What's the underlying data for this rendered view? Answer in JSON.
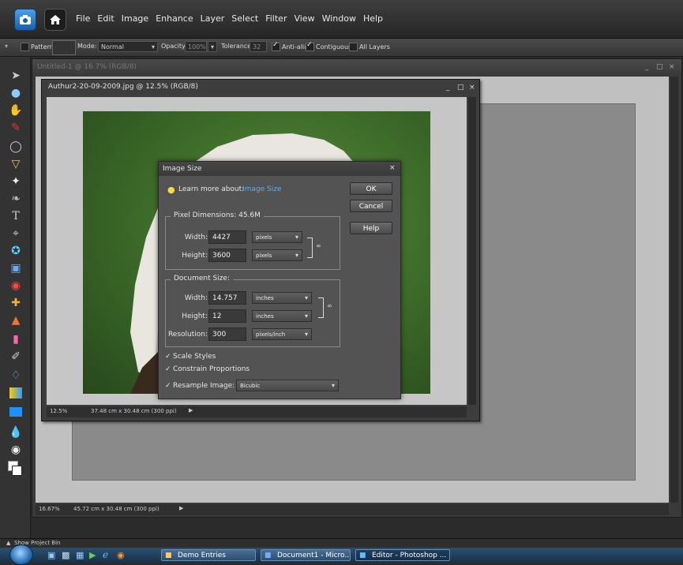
{
  "menubar": {
    "items": [
      "File",
      "Edit",
      "Image",
      "Enhance",
      "Layer",
      "Select",
      "Filter",
      "View",
      "Window",
      "Help"
    ]
  },
  "options_bar": {
    "pattern_label": "Pattern",
    "mode_label": "Mode:",
    "mode_value": "Normal",
    "opacity_label": "Opacity:",
    "opacity_value": "100%",
    "tolerance_label": "Tolerance:",
    "tolerance_value": "32",
    "anti_alias_label": "Anti-alias",
    "contiguous_label": "Contiguous",
    "all_layers_label": "All Layers"
  },
  "doc1": {
    "title": "Untitled-1 @ 16.7% (RGB/8)",
    "zoom": "16.67%",
    "status": "45.72 cm x 30.48 cm (300 ppi)"
  },
  "doc2": {
    "title": "Authur2-20-09-2009.jpg @ 12.5% (RGB/8)",
    "zoom": "12.5%",
    "status": "37.48 cm x 30.48 cm (300 ppi)"
  },
  "dialog": {
    "title": "Image Size",
    "learn_more_label": "Learn more about:",
    "learn_more_link": "Image Size",
    "ok_label": "OK",
    "cancel_label": "Cancel",
    "help_label": "Help",
    "pixel_dimensions": {
      "legend": "Pixel Dimensions: 45.6M",
      "width_label": "Width:",
      "width_value": "4427",
      "width_unit": "pixels",
      "height_label": "Height:",
      "height_value": "3600",
      "height_unit": "pixels"
    },
    "document_size": {
      "legend": "Document Size:",
      "width_label": "Width:",
      "width_value": "14.757",
      "width_unit": "inches",
      "height_label": "Height:",
      "height_value": "12",
      "height_unit": "inches",
      "resolution_label": "Resolution:",
      "resolution_value": "300",
      "resolution_unit": "pixels/inch"
    },
    "scale_styles_label": "Scale Styles",
    "constrain_label": "Constrain Proportions",
    "resample_label": "Resample Image:",
    "resample_value": "Bicubic"
  },
  "project_bin": {
    "label": "Show Project Bin"
  },
  "taskbar": {
    "tasks": [
      "Demo Entries",
      "Document1 - Micro...",
      "Editor - Photoshop ..."
    ]
  },
  "colors": {
    "link": "#4fb3ff",
    "menubar_bg": "#2f2f2f",
    "canvas_bg": "#c0c0c0",
    "photo_green": "#3f6e2b"
  }
}
